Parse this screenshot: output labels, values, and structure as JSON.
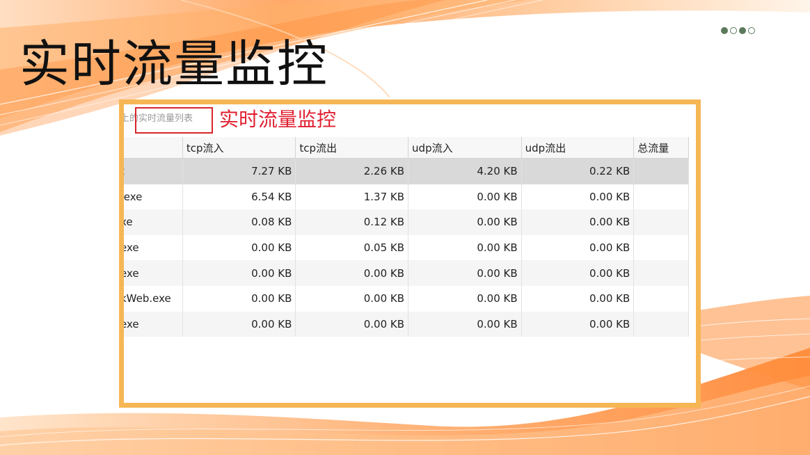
{
  "slide": {
    "title": "实时流量监控",
    "pager_dots": [
      true,
      false,
      true,
      false
    ]
  },
  "screenshot": {
    "list_label": "上的实时流量列表",
    "annotation_caption": "实时流量监控",
    "annotation_color": "#e02030",
    "frame_color": "#f6b654",
    "table": {
      "headers": [
        "",
        "tcp流入",
        "tcp流出",
        "udp流入",
        "udp流出",
        "总流量"
      ],
      "rows": [
        [
          "t",
          "7.27 KB",
          "2.26 KB",
          "4.20 KB",
          "0.22 KB",
          ""
        ],
        [
          ".exe",
          "6.54 KB",
          "1.37 KB",
          "0.00 KB",
          "0.00 KB",
          ""
        ],
        [
          "xe",
          "0.08 KB",
          "0.12 KB",
          "0.00 KB",
          "0.00 KB",
          ""
        ],
        [
          "exe",
          "0.00 KB",
          "0.05 KB",
          "0.00 KB",
          "0.00 KB",
          ""
        ],
        [
          "exe",
          "0.00 KB",
          "0.00 KB",
          "0.00 KB",
          "0.00 KB",
          ""
        ],
        [
          "kWeb.exe",
          "0.00 KB",
          "0.00 KB",
          "0.00 KB",
          "0.00 KB",
          ""
        ],
        [
          "exe",
          "0.00 KB",
          "0.00 KB",
          "0.00 KB",
          "0.00 KB",
          ""
        ]
      ]
    }
  }
}
